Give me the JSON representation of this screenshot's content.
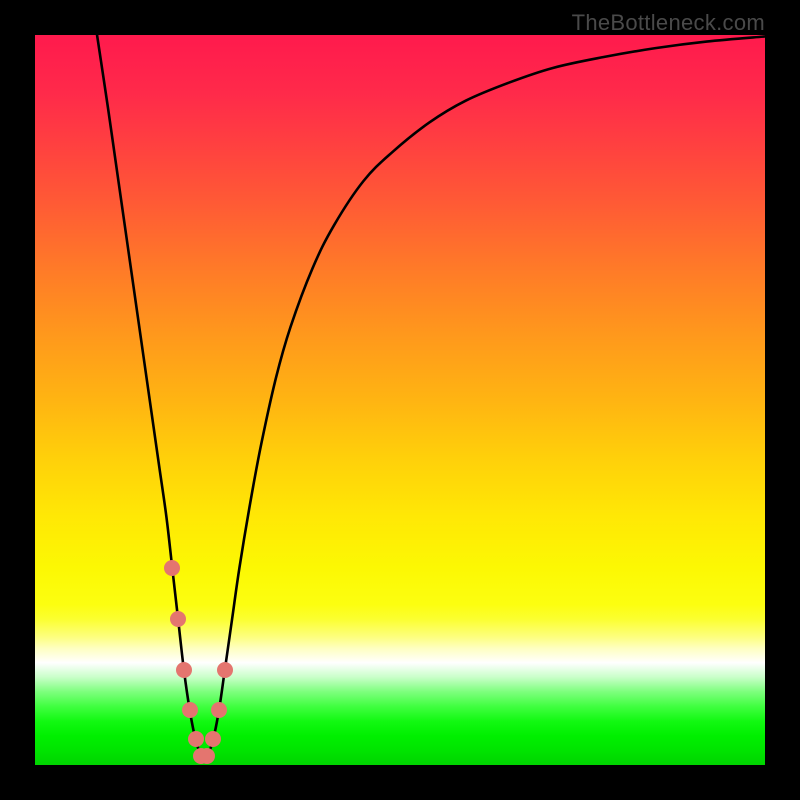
{
  "watermark": "TheBottleneck.com",
  "colors": {
    "page_bg": "#000000",
    "gradient_top": "#ff1a4d",
    "gradient_bottom": "#00d400",
    "curve": "#000000",
    "marker": "#e4756f",
    "label": "#4a4a4a"
  },
  "chart_data": {
    "type": "line",
    "title": "",
    "xlabel": "",
    "ylabel": "",
    "xlim": [
      0,
      100
    ],
    "ylim": [
      0,
      100
    ],
    "series": [
      {
        "name": "bottleneck-curve",
        "x": [
          8.5,
          10,
          11,
          12,
          13,
          14,
          15,
          16,
          17,
          18,
          18.8,
          19.6,
          20.4,
          21.2,
          22,
          22.8,
          23.6,
          24.4,
          25.2,
          26,
          27,
          28,
          29.5,
          31,
          33,
          35,
          38,
          41,
          45,
          49,
          54,
          59,
          65,
          71,
          78,
          85,
          92,
          100
        ],
        "y": [
          100,
          90,
          83,
          76,
          69,
          62,
          55,
          48,
          41,
          34,
          27,
          20,
          13,
          7.5,
          3.5,
          1.3,
          1.3,
          3.5,
          7.5,
          13,
          20,
          27,
          36,
          44,
          53,
          60,
          68,
          74,
          80,
          84,
          88,
          91,
          93.5,
          95.5,
          97,
          98.2,
          99.1,
          99.8
        ]
      }
    ],
    "markers": {
      "name": "highlight-points",
      "x": [
        18.8,
        19.6,
        20.4,
        21.2,
        22.0,
        22.8,
        23.6,
        24.4,
        25.2,
        26.0
      ],
      "y": [
        27,
        20,
        13,
        7.5,
        3.5,
        1.3,
        1.3,
        3.5,
        7.5,
        13
      ]
    },
    "axes_visible": false,
    "grid": false
  }
}
